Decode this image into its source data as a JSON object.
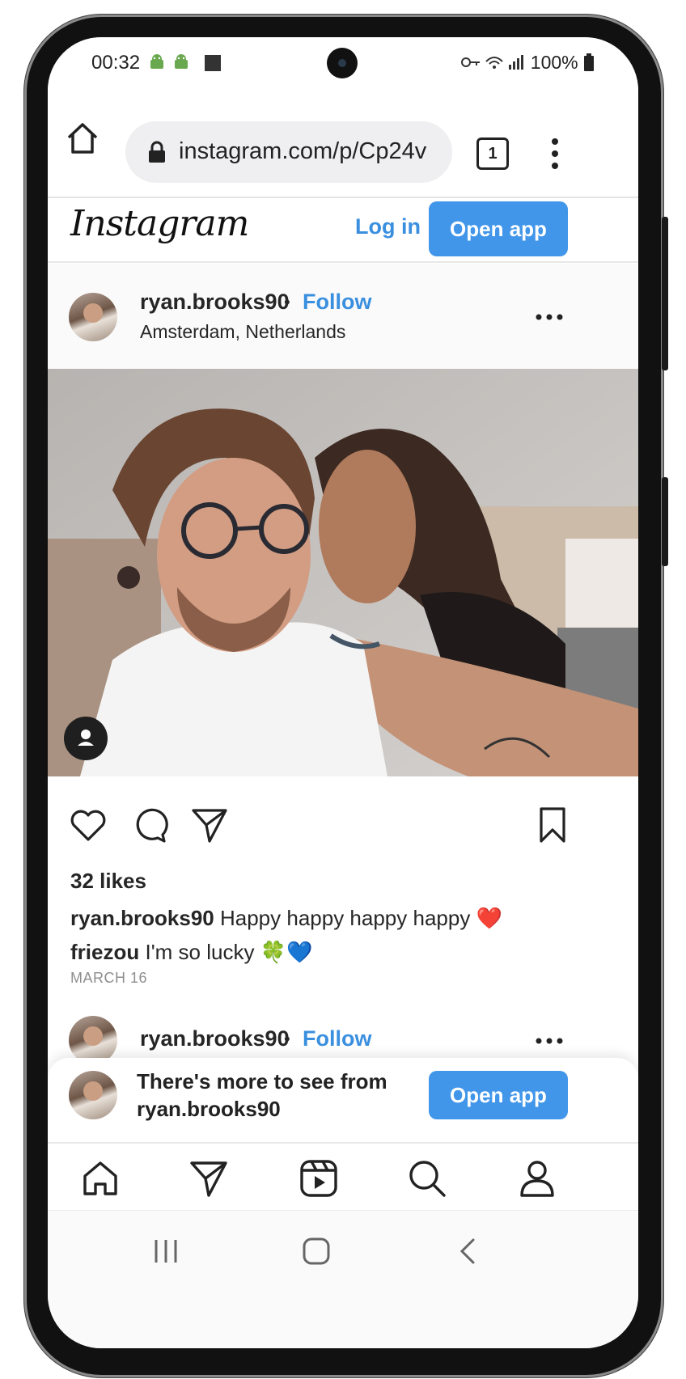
{
  "status_bar": {
    "time": "00:32",
    "battery": "100%"
  },
  "browser": {
    "url": "instagram.com/p/Cp24v",
    "tab_count": "1"
  },
  "ig_header": {
    "logo": "Instagram",
    "login": "Log in",
    "open_app": "Open app"
  },
  "post": {
    "username": "ryan.brooks90",
    "dot": "•",
    "follow": "Follow",
    "location": "Amsterdam, Netherlands",
    "likes": "32 likes",
    "caption_user": "ryan.brooks90",
    "caption_text": "Happy happy happy happy ❤️",
    "comment_user": "friezou",
    "comment_text": "I'm so lucky 🍀💙",
    "date": "MARCH 16"
  },
  "next_post": {
    "username": "ryan.brooks90",
    "dot": "•",
    "follow": "Follow"
  },
  "banner": {
    "line1": "There's more to see from",
    "line2": "ryan.brooks90",
    "button": "Open app"
  },
  "icons": {
    "home": "home-icon",
    "lock": "lock-icon",
    "tabs": "tabs-icon",
    "menu": "more-vert-icon",
    "like": "heart-icon",
    "comment": "comment-icon",
    "share": "send-icon",
    "save": "bookmark-icon",
    "nav_home": "home-icon",
    "nav_send": "send-icon",
    "nav_reels": "reels-icon",
    "nav_search": "search-icon",
    "nav_profile": "profile-icon"
  },
  "colors": {
    "accent": "#4196ea",
    "link": "#3a8fdf"
  }
}
